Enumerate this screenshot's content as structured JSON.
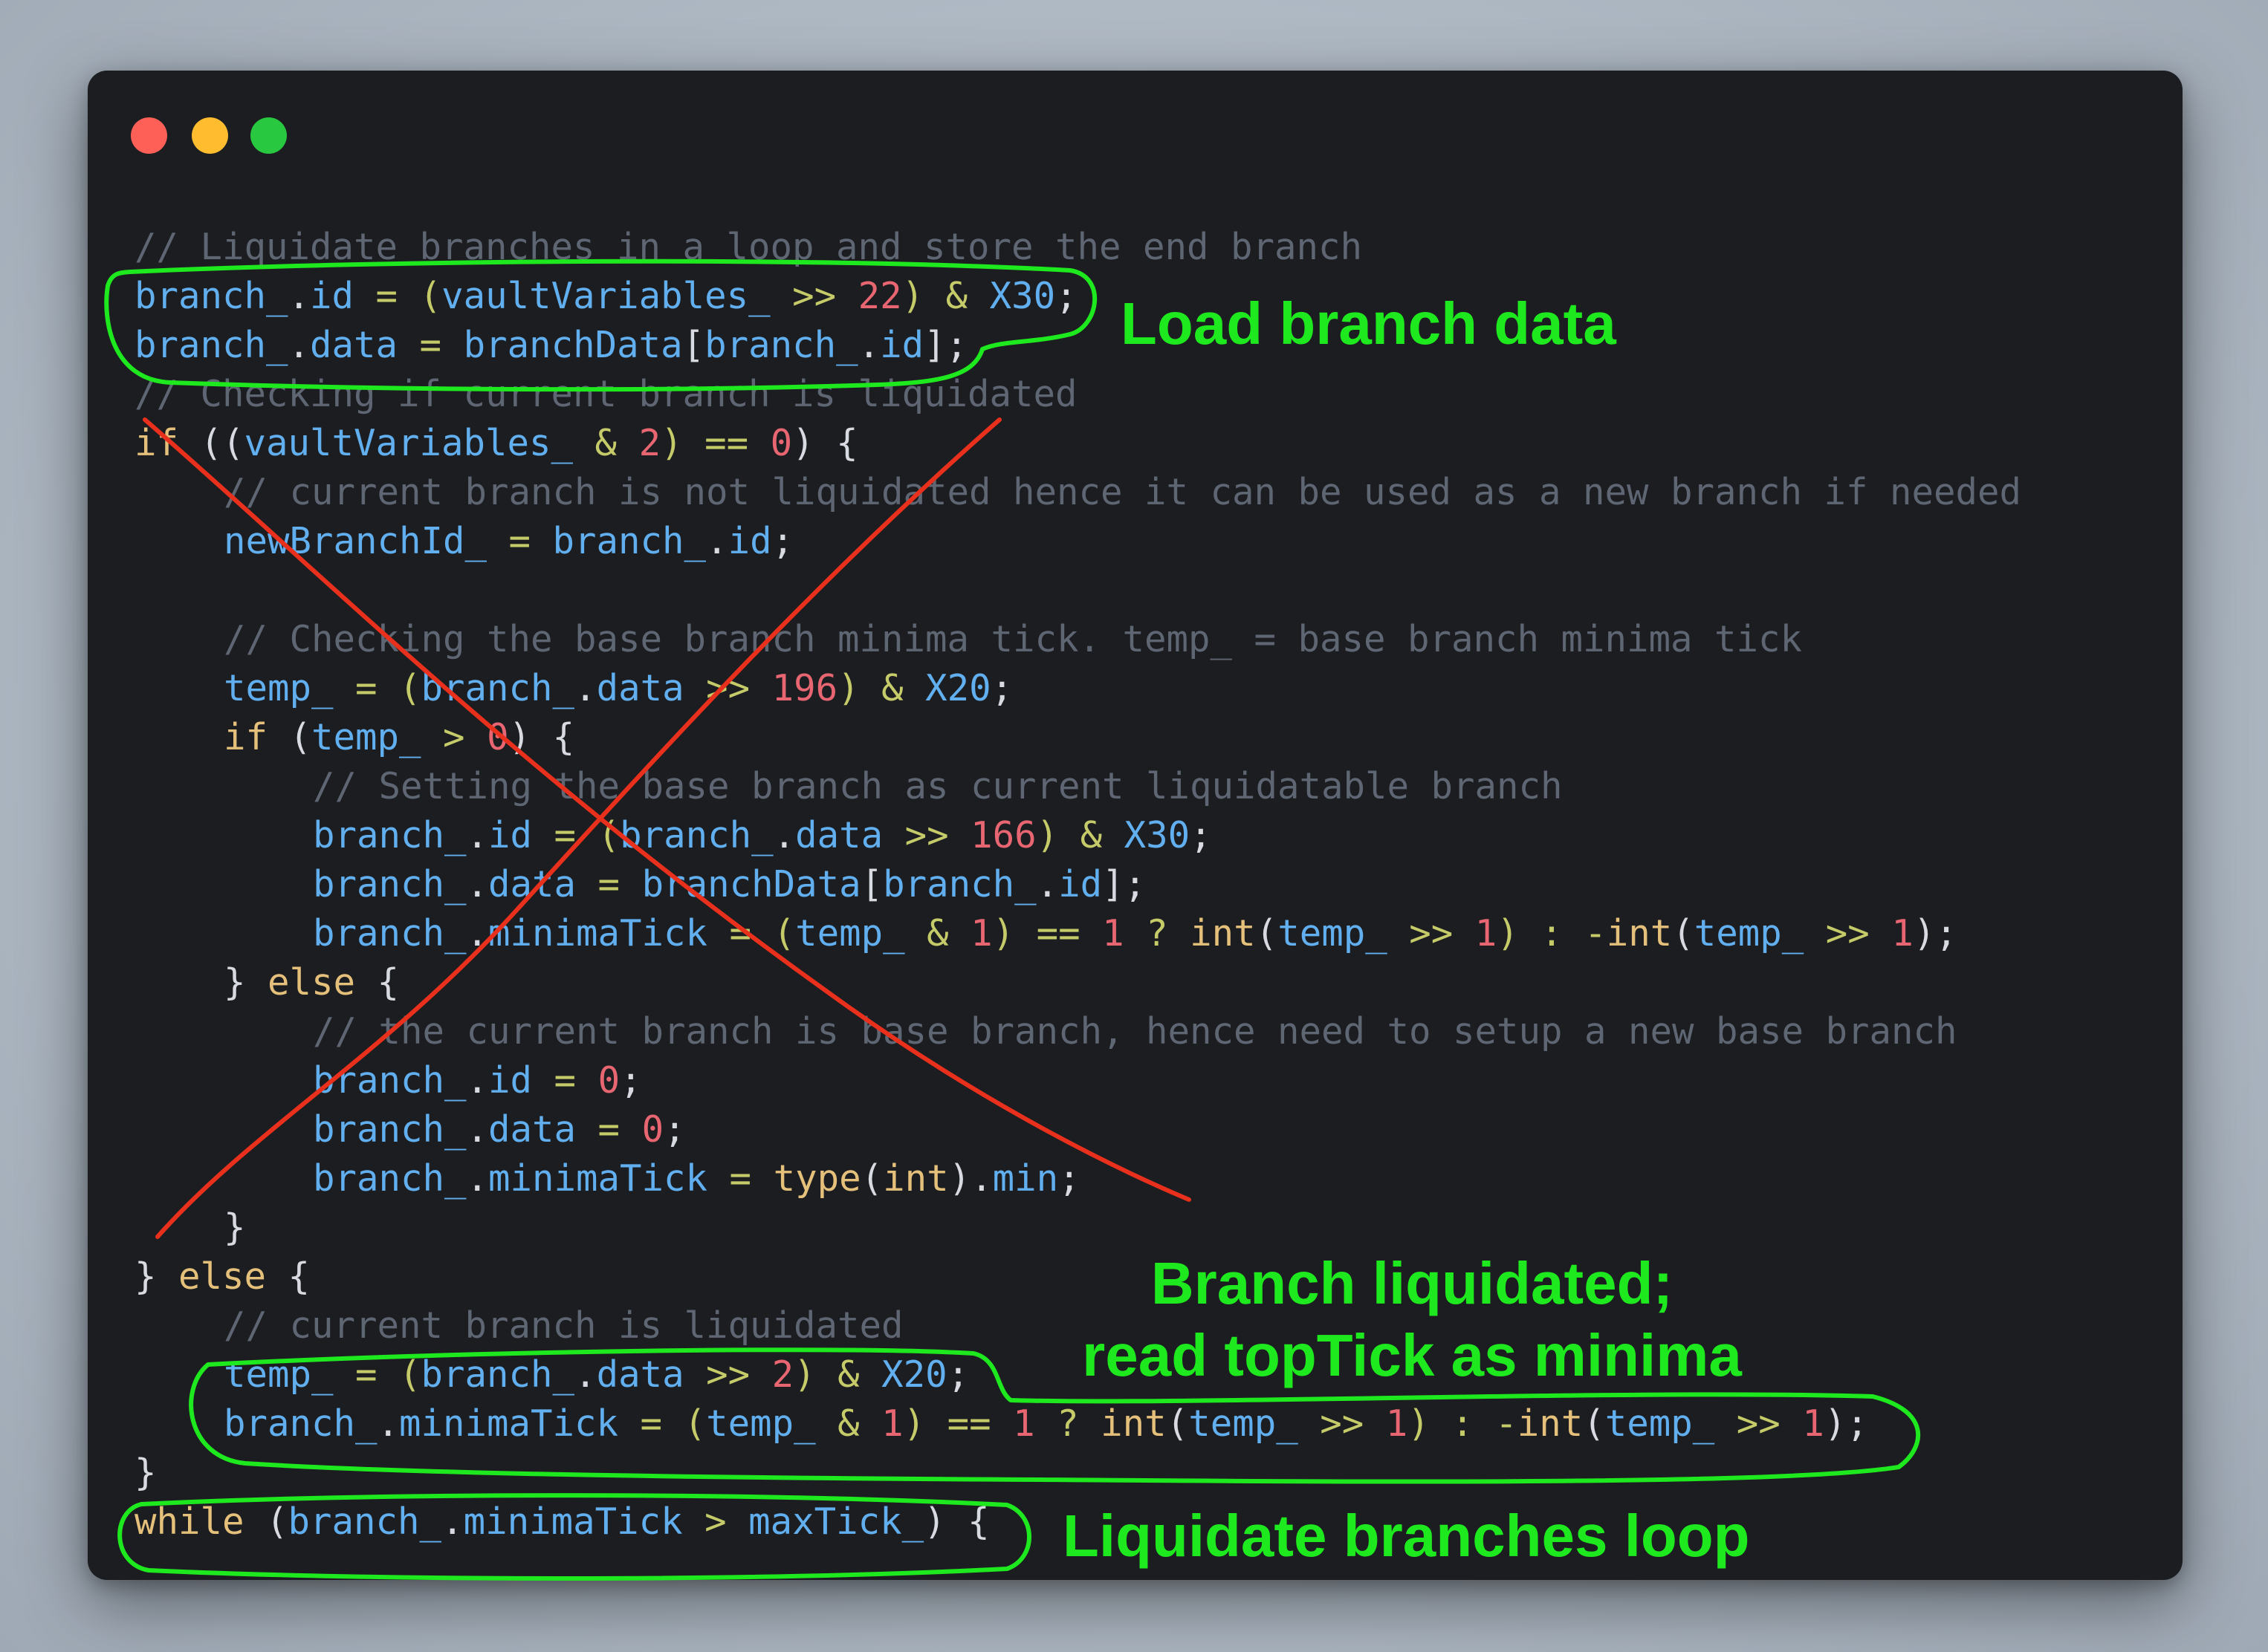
{
  "window": {
    "traffic_lights": [
      "close",
      "minimize",
      "zoom"
    ],
    "colors": {
      "background": "#1c1d21",
      "close": "#fe5f57",
      "minimize": "#febc2e",
      "zoom": "#28c840"
    }
  },
  "code": {
    "l1": {
      "comment": "// Liquidate branches in a loop and store the end branch"
    },
    "l2": {
      "a": "branch_",
      "b": ".",
      "c": "id",
      "d": " = (",
      "e": "vaultVariables_",
      "f": " >> ",
      "g": "22",
      "h": ") & ",
      "i": "X30",
      "j": ";"
    },
    "l3": {
      "a": "branch_",
      "b": ".",
      "c": "data",
      "d": " = ",
      "e": "branchData",
      "f": "[",
      "g": "branch_",
      "h": ".",
      "i": "id",
      "j": "];"
    },
    "l4": {
      "comment": "// Checking if current branch is liquidated"
    },
    "l5": {
      "a": "if",
      "b": " ((",
      "c": "vaultVariables_",
      "d": " & ",
      "e": "2",
      "f": ") == ",
      "g": "0",
      "h": ") {"
    },
    "l6": {
      "comment": "// current branch is not liquidated hence it can be used as a new branch if needed"
    },
    "l7": {
      "a": "newBranchId_",
      "b": " = ",
      "c": "branch_",
      "d": ".",
      "e": "id",
      "f": ";"
    },
    "l8": {
      "comment": "// Checking the base branch minima tick. temp_ = base branch minima tick"
    },
    "l9": {
      "a": "temp_",
      "b": " = (",
      "c": "branch_",
      "d": ".",
      "e": "data",
      "f": " >> ",
      "g": "196",
      "h": ") & ",
      "i": "X20",
      "j": ";"
    },
    "l10": {
      "a": "if",
      "b": " (",
      "c": "temp_",
      "d": " > ",
      "e": "0",
      "f": ") {"
    },
    "l11": {
      "comment": "// Setting the base branch as current liquidatable branch"
    },
    "l12": {
      "a": "branch_",
      "b": ".",
      "c": "id",
      "d": " = (",
      "e": "branch_",
      "f": ".",
      "g": "data",
      "h": " >> ",
      "i": "166",
      "j": ") & ",
      "k": "X30",
      "l": ";"
    },
    "l13": {
      "a": "branch_",
      "b": ".",
      "c": "data",
      "d": " = ",
      "e": "branchData",
      "f": "[",
      "g": "branch_",
      "h": ".",
      "i": "id",
      "j": "];"
    },
    "l14": {
      "a": "branch_",
      "b": ".",
      "c": "minimaTick",
      "d": " = (",
      "e": "temp_",
      "f": " & ",
      "g": "1",
      "h": ") == ",
      "i": "1",
      "j": " ? ",
      "k": "int",
      "l": "(",
      "m": "temp_",
      "n": " >> ",
      "o": "1",
      "p": ") : -",
      "q": "int",
      "r": "(",
      "s": "temp_",
      "t": " >> ",
      "u": "1",
      "v": ");"
    },
    "l15": {
      "a": "} ",
      "b": "else",
      "c": " {"
    },
    "l16": {
      "comment": "// the current branch is base branch, hence need to setup a new base branch"
    },
    "l17": {
      "a": "branch_",
      "b": ".",
      "c": "id",
      "d": " = ",
      "e": "0",
      "f": ";"
    },
    "l18": {
      "a": "branch_",
      "b": ".",
      "c": "data",
      "d": " = ",
      "e": "0",
      "f": ";"
    },
    "l19": {
      "a": "branch_",
      "b": ".",
      "c": "minimaTick",
      "d": " = ",
      "e": "type",
      "f": "(",
      "g": "int",
      "h": ").",
      "i": "min",
      "j": ";"
    },
    "l20": {
      "a": "}"
    },
    "l21": {
      "a": "} ",
      "b": "else",
      "c": " {"
    },
    "l22": {
      "comment": "// current branch is liquidated"
    },
    "l23": {
      "a": "temp_",
      "b": " = (",
      "c": "branch_",
      "d": ".",
      "e": "data",
      "f": " >> ",
      "g": "2",
      "h": ") & ",
      "i": "X20",
      "j": ";"
    },
    "l24": {
      "a": "branch_",
      "b": ".",
      "c": "minimaTick",
      "d": " = (",
      "e": "temp_",
      "f": " & ",
      "g": "1",
      "h": ") == ",
      "i": "1",
      "j": " ? ",
      "k": "int",
      "l": "(",
      "m": "temp_",
      "n": " >> ",
      "o": "1",
      "p": ") : -",
      "q": "int",
      "r": "(",
      "s": "temp_",
      "t": " >> ",
      "u": "1",
      "v": ");"
    },
    "l25": {
      "a": "}"
    },
    "l26": {
      "a": "while",
      "b": " (",
      "c": "branch_",
      "d": ".",
      "e": "minimaTick",
      "f": " > ",
      "g": "maxTick_",
      "h": ") {"
    }
  },
  "annotations": {
    "load": "Load branch data",
    "liquidated_1": "Branch liquidated;",
    "liquidated_2": "read topTick as minima",
    "loop": "Liquidate branches loop",
    "colors": {
      "highlight": "#1ee81e",
      "cross_out": "#e8301c"
    }
  }
}
